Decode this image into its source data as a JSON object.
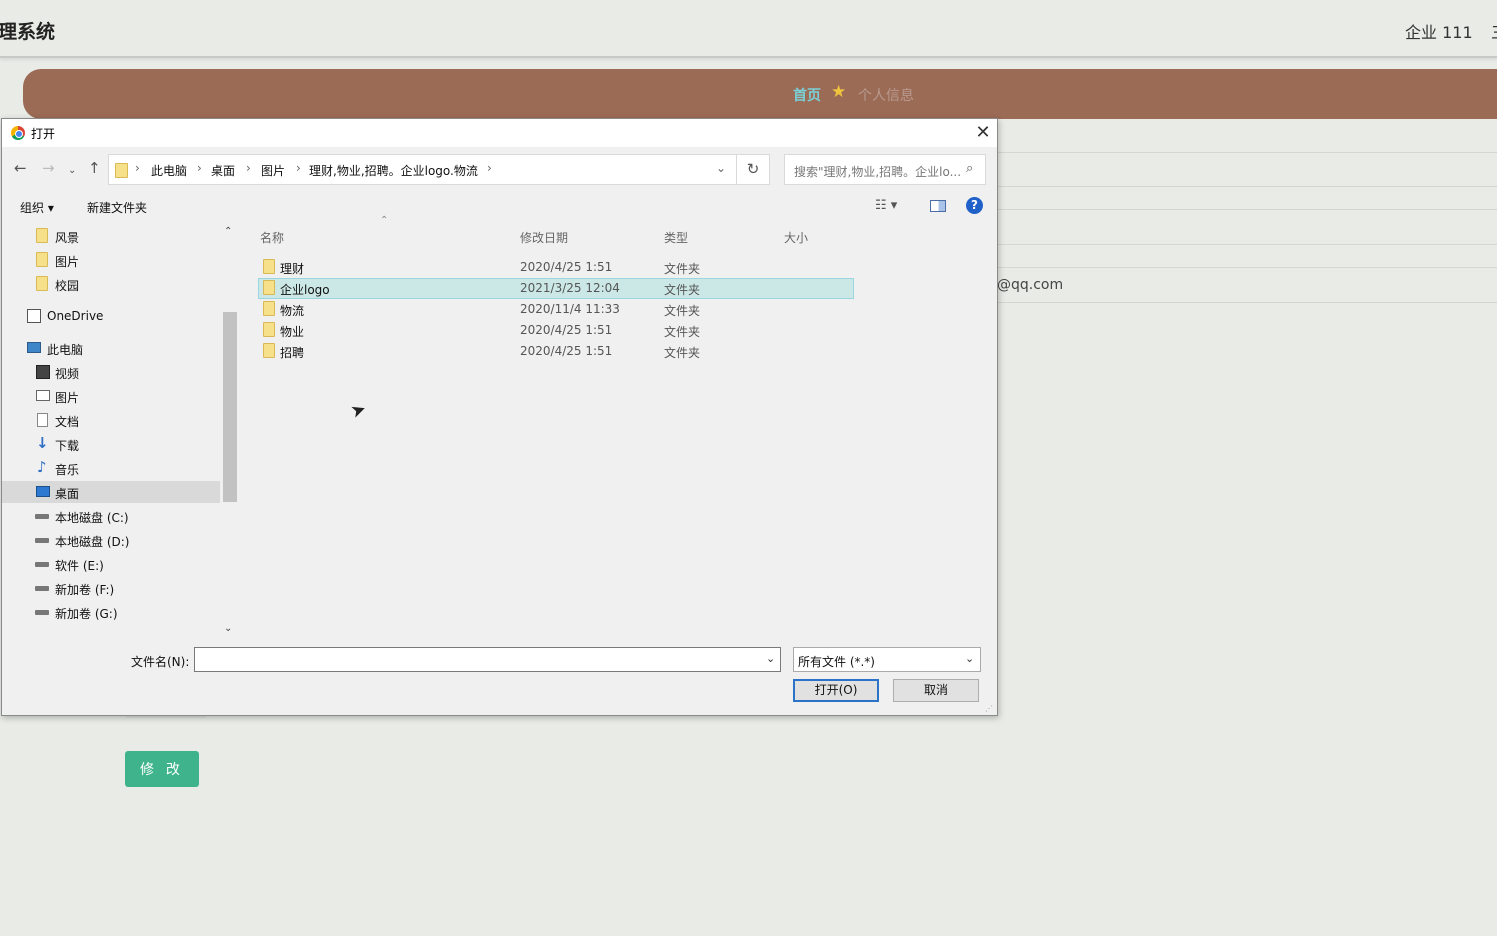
{
  "app": {
    "title": "理系统",
    "user": "企业 111",
    "user_more": "三",
    "nav_home": "首页",
    "nav_profile": "个人信息",
    "email_partial": "@qq.com",
    "edit_button": "修 改"
  },
  "dialog": {
    "title": "打开",
    "breadcrumb": [
      "此电脑",
      "桌面",
      "图片",
      "理财,物业,招聘。企业logo.物流"
    ],
    "search_placeholder": "搜索\"理财,物业,招聘。企业lo...",
    "toolbar": {
      "organize": "组织 ▾",
      "new_folder": "新建文件夹"
    },
    "tree": [
      {
        "label": "风景",
        "icon": "folder-icon"
      },
      {
        "label": "图片",
        "icon": "folder-icon"
      },
      {
        "label": "校园",
        "icon": "folder-icon"
      },
      {
        "label": "OneDrive",
        "icon": "onedrive-icon"
      },
      {
        "label": "此电脑",
        "icon": "computer-icon"
      },
      {
        "label": "视频",
        "icon": "video-icon"
      },
      {
        "label": "图片",
        "icon": "pictures-icon"
      },
      {
        "label": "文档",
        "icon": "document-icon"
      },
      {
        "label": "下载",
        "icon": "download-icon"
      },
      {
        "label": "音乐",
        "icon": "music-icon"
      },
      {
        "label": "桌面",
        "icon": "desktop-icon",
        "selected": true
      },
      {
        "label": "本地磁盘 (C:)",
        "icon": "drive-icon"
      },
      {
        "label": "本地磁盘 (D:)",
        "icon": "drive-icon"
      },
      {
        "label": "软件 (E:)",
        "icon": "drive-icon"
      },
      {
        "label": "新加卷 (F:)",
        "icon": "drive-icon"
      },
      {
        "label": "新加卷 (G:)",
        "icon": "drive-icon"
      }
    ],
    "columns": {
      "name": "名称",
      "date": "修改日期",
      "type": "类型",
      "size": "大小"
    },
    "files": [
      {
        "name": "理财",
        "date": "2020/4/25 1:51",
        "type": "文件夹"
      },
      {
        "name": "企业logo",
        "date": "2021/3/25 12:04",
        "type": "文件夹",
        "selected": true
      },
      {
        "name": "物流",
        "date": "2020/11/4 11:33",
        "type": "文件夹"
      },
      {
        "name": "物业",
        "date": "2020/4/25 1:51",
        "type": "文件夹"
      },
      {
        "name": "招聘",
        "date": "2020/4/25 1:51",
        "type": "文件夹"
      }
    ],
    "filename_label": "文件名(N):",
    "filename_value": "",
    "filter_value": "所有文件 (*.*)",
    "open_button": "打开(O)",
    "cancel_button": "取消"
  }
}
